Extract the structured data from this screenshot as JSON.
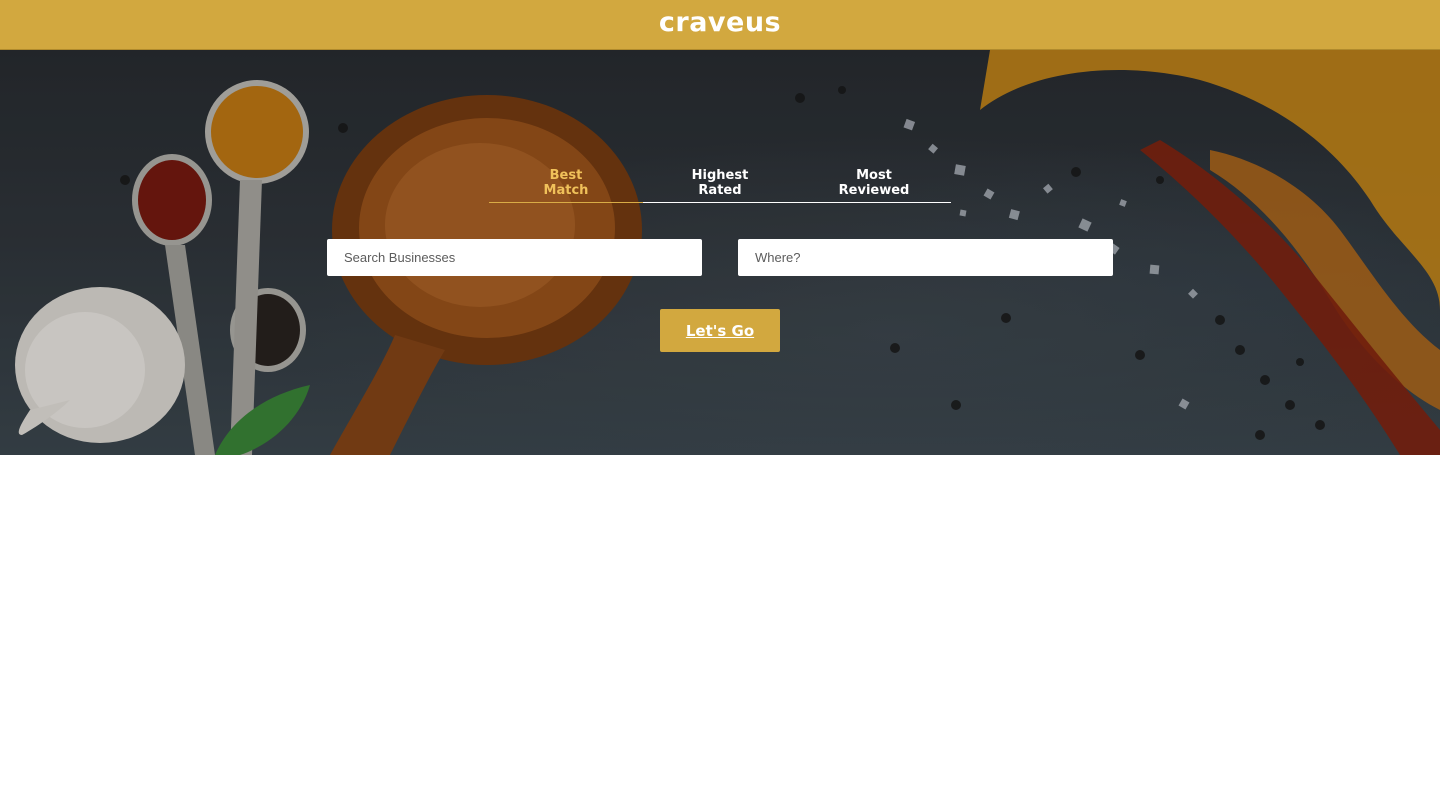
{
  "app": {
    "logo": "craveus",
    "brand_color": "#d2a83f",
    "active_tab_color": "#f0c15a"
  },
  "search_bar": {
    "sort_options": [
      {
        "label": "Best\nMatch",
        "active": true
      },
      {
        "label": "Highest\nRated",
        "active": false
      },
      {
        "label": "Most\nReviewed",
        "active": false
      }
    ],
    "business_input": {
      "value": "",
      "placeholder": "Search Businesses"
    },
    "location_input": {
      "value": "",
      "placeholder": "Where?"
    },
    "submit_label": "Let's Go"
  },
  "hero": {
    "background_icon": "spices-on-slate-photo"
  },
  "results": {
    "items": []
  }
}
